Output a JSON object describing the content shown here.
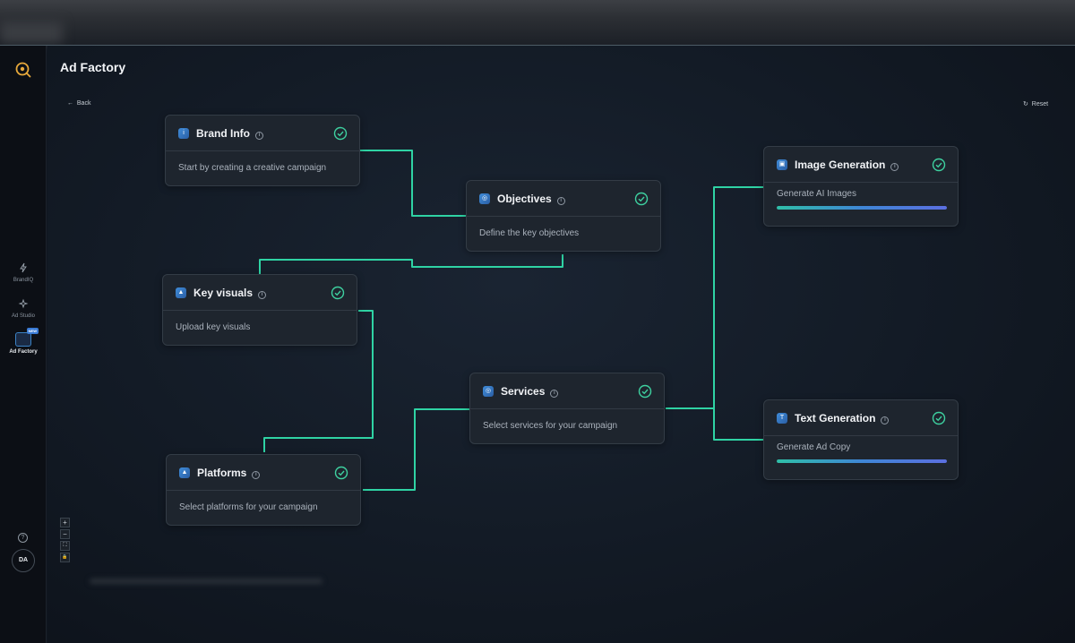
{
  "app": {
    "title": "Ad Factory"
  },
  "sidebar": {
    "items": [
      {
        "label": "BrandIQ",
        "icon": "lightning-icon"
      },
      {
        "label": "Ad Studio",
        "icon": "sparkle-icon"
      },
      {
        "label": "Ad Factory",
        "icon": "factory-icon",
        "badge": "NEW",
        "active": true
      }
    ],
    "avatar": "DA"
  },
  "toolbar": {
    "back_label": "Back",
    "reset_label": "Reset"
  },
  "nodes": {
    "brand_info": {
      "title": "Brand Info",
      "desc": "Start by creating a creative campaign",
      "status": "complete"
    },
    "objectives": {
      "title": "Objectives",
      "desc": "Define the key objectives",
      "status": "complete"
    },
    "key_visuals": {
      "title": "Key visuals",
      "desc": "Upload key visuals",
      "status": "complete"
    },
    "platforms": {
      "title": "Platforms",
      "desc": "Select platforms for your campaign",
      "status": "complete"
    },
    "services": {
      "title": "Services",
      "desc": "Select services for your campaign",
      "status": "complete"
    },
    "image_generation": {
      "title": "Image Generation",
      "desc": "Generate AI Images",
      "status": "complete",
      "progress": 1.0
    },
    "text_generation": {
      "title": "Text Generation",
      "desc": "Generate Ad Copy",
      "status": "complete",
      "progress": 1.0
    }
  },
  "zoom_controls": [
    "+",
    "−",
    "⛶",
    "🔒"
  ],
  "colors": {
    "wire": "#2fd3a4",
    "check": "#3ed1a0",
    "accent": "#3f86d6",
    "background": "#101620"
  }
}
